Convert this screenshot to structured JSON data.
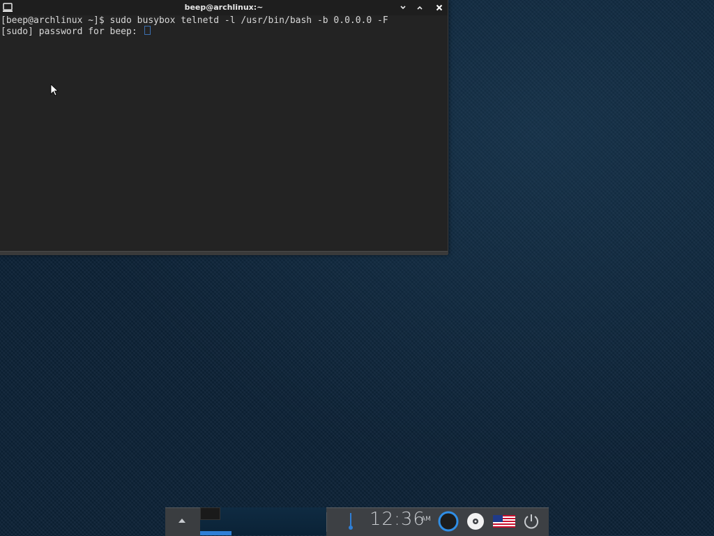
{
  "window": {
    "title": "beep@archlinux:~",
    "app_icon": "terminal-icon",
    "buttons": [
      "minimize-icon",
      "maximize-icon",
      "close-icon"
    ]
  },
  "terminal": {
    "lines": [
      "[beep@archlinux ~]$ sudo busybox telnetd -l /usr/bin/bash -b 0.0.0.0 -F",
      "[sudo] password for beep: "
    ]
  },
  "taskbar": {
    "menu_icon": "chevron-up-icon",
    "clock_time": "12:36",
    "clock_ampm": "AM",
    "tray_icons": [
      "thermometer-icon",
      "network-ring-icon",
      "disc-icon",
      "us-flag-icon",
      "power-icon"
    ],
    "accent": "#2f7fd6"
  },
  "colors": {
    "desktop": "#0c2236",
    "terminal_bg": "#232323",
    "titlebar_bg": "#1e1e1e"
  }
}
